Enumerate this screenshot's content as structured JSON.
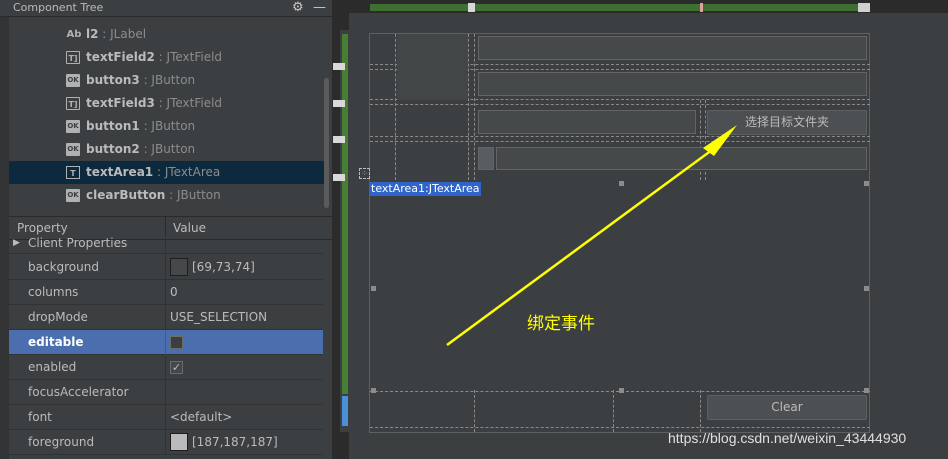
{
  "component_tree": {
    "title": "Component Tree",
    "items": [
      {
        "icon": "label-icon",
        "icon_text": "Ab",
        "name": "l2",
        "type": " : JLabel"
      },
      {
        "icon": "textfield-icon",
        "icon_text": "T]",
        "name": "textField2",
        "type": " : JTextField"
      },
      {
        "icon": "button-icon",
        "icon_text": "OK",
        "name": "button3",
        "type": " : JButton"
      },
      {
        "icon": "textfield-icon",
        "icon_text": "T]",
        "name": "textField3",
        "type": " : JTextField"
      },
      {
        "icon": "button-icon",
        "icon_text": "OK",
        "name": "button1",
        "type": " : JButton"
      },
      {
        "icon": "button-icon",
        "icon_text": "OK",
        "name": "button2",
        "type": " : JButton"
      },
      {
        "icon": "textarea-icon",
        "icon_text": "T",
        "name": "textArea1",
        "type": " : JTextArea",
        "selected": true
      },
      {
        "icon": "button-icon",
        "icon_text": "OK",
        "name": "clearButton",
        "type": " : JButton"
      }
    ]
  },
  "properties": {
    "header": {
      "property": "Property",
      "value": "Value"
    },
    "rows": [
      {
        "key": "Client Properties",
        "value": ""
      },
      {
        "key": "background",
        "value": "[69,73,74]",
        "swatch": "#45494a"
      },
      {
        "key": "columns",
        "value": "0"
      },
      {
        "key": "dropMode",
        "value": "USE_SELECTION"
      },
      {
        "key": "editable",
        "value": "",
        "checkbox": false,
        "selected": true
      },
      {
        "key": "enabled",
        "value": "",
        "checkbox": true
      },
      {
        "key": "focusAccelerator",
        "value": ""
      },
      {
        "key": "font",
        "value": "<default>"
      },
      {
        "key": "foreground",
        "value": "[187,187,187]",
        "swatch": "#bbbbbb"
      }
    ]
  },
  "designer": {
    "choose_button": "选择目标文件夹",
    "clear_button": "Clear",
    "textarea_label": "textArea1:JTextArea"
  },
  "annotation": {
    "text": "绑定事件",
    "arrow_color": "#ffff00"
  },
  "watermark": "https://blog.csdn.net/weixin_43444930",
  "colors": {
    "panel": "#3c3f41",
    "selection_tree": "#0d293e",
    "selection_prop": "#4b6eaf",
    "label_highlight": "#2f65ca"
  }
}
